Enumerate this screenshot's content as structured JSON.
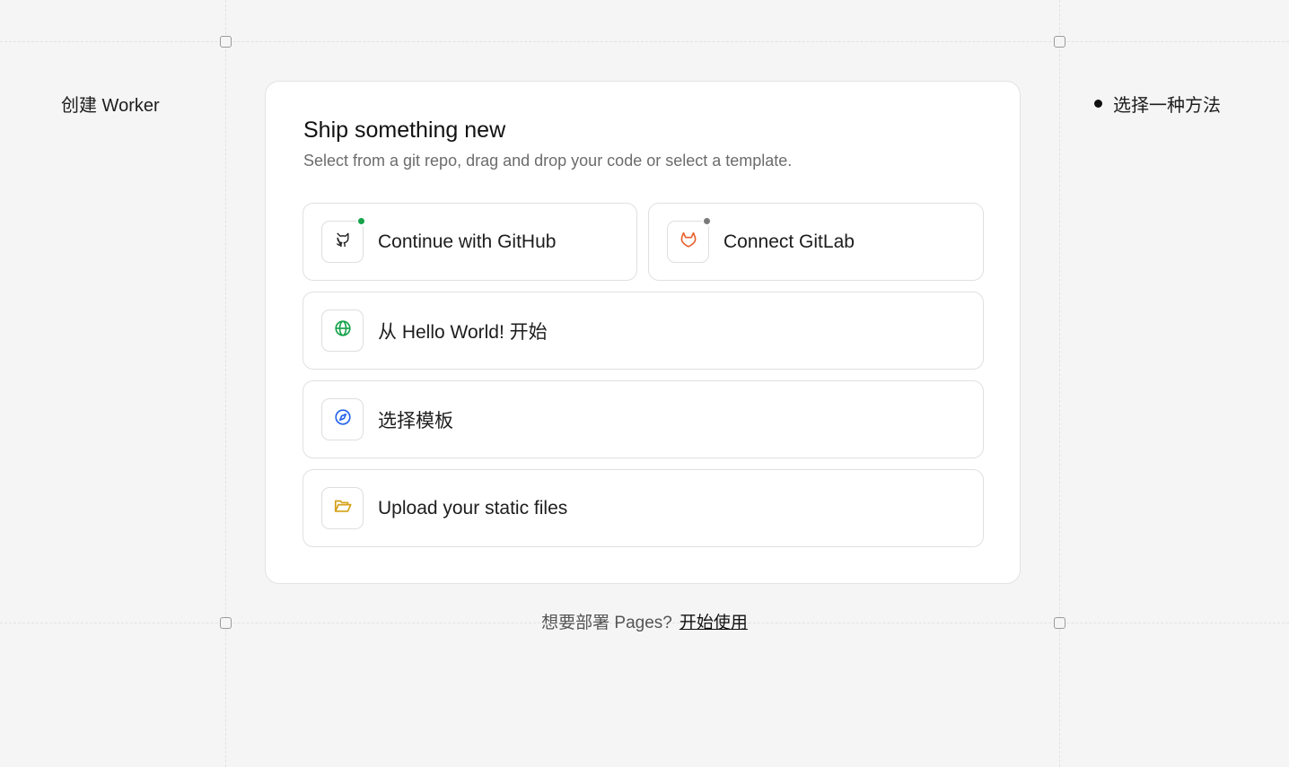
{
  "left_panel": {
    "title": "创建 Worker"
  },
  "right_panel": {
    "step_label": "选择一种方法"
  },
  "card": {
    "title": "Ship something new",
    "subtitle": "Select from a git repo, drag and drop your code or select a template."
  },
  "options": {
    "github": {
      "label": "Continue with GitHub",
      "icon": "github-icon",
      "status_color": "#16a34a"
    },
    "gitlab": {
      "label": "Connect GitLab",
      "icon": "gitlab-icon",
      "status_color": "#7a7a7a"
    },
    "hello_world": {
      "label": "从 Hello World! 开始",
      "icon": "globe-icon",
      "icon_color": "#16a34a"
    },
    "template": {
      "label": "选择模板",
      "icon": "compass-icon",
      "icon_color": "#2563eb"
    },
    "upload": {
      "label": "Upload your static files",
      "icon": "folder-icon",
      "icon_color": "#d4a017"
    }
  },
  "footer": {
    "prompt": "想要部署 Pages?",
    "link": "开始使用"
  }
}
